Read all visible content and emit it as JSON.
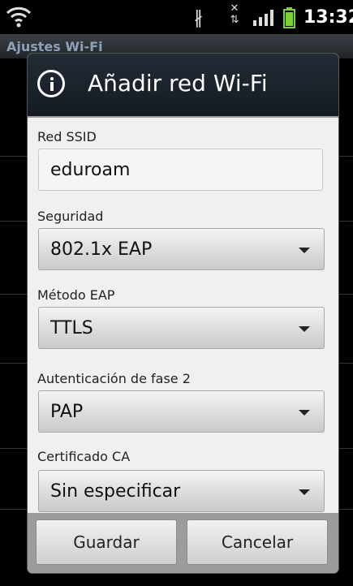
{
  "status_bar": {
    "time": "13:32",
    "icons": [
      "wifi-icon",
      "bluetooth-icon",
      "data-transfer-icon",
      "signal-icon",
      "battery-icon"
    ]
  },
  "background_screen": {
    "title": "Ajustes Wi-Fi"
  },
  "dialog": {
    "title": "Añadir red Wi-Fi",
    "fields": {
      "ssid_label": "Red SSID",
      "ssid_value": "eduroam",
      "security_label": "Seguridad",
      "security_value": "802.1x EAP",
      "eap_method_label": "Método EAP",
      "eap_method_value": "TTLS",
      "phase2_label": "Autenticación de fase 2",
      "phase2_value": "PAP",
      "ca_cert_label": "Certificado CA",
      "ca_cert_value": "Sin especificar"
    },
    "buttons": {
      "save": "Guardar",
      "cancel": "Cancelar"
    }
  },
  "colors": {
    "dialog_header": "#1a222b",
    "dialog_body": "#f0f0f0",
    "footer": "#9c9c9c",
    "bg_title_text": "#8ea0b5"
  }
}
